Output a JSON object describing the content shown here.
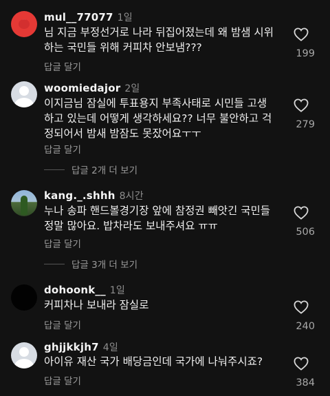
{
  "comments": [
    {
      "username": "mul__77077",
      "time": "1일",
      "text": "님 지금 부정선거로 나라 뒤집어졌는데 왜 밤샘 시위\n하는 국민들 위해 커피차 안보냄???",
      "reply_label": "답글 달기",
      "likes": "199",
      "avatar": "red-character-avatar"
    },
    {
      "username": "woomiedajor",
      "time": "2일",
      "text": "이지금님 잠실에 투표용지 부족사태로 시민들 고생\n하고 있는데 어떻게 생각하세요?? 너무 불안하고 걱\n정되어서 밤새 밤잠도 못잤어요ㅜㅜ",
      "reply_label": "답글 달기",
      "likes": "279",
      "more_replies": "답글 2개 더 보기",
      "avatar": "default-avatar"
    },
    {
      "username": "kang._.shhh",
      "time": "8시간",
      "text": "누나 송파 핸드볼경기장 앞에 참정권 빼앗긴 국민들\n정말 많아요. 밥차라도 보내주셔요 ㅠㅠ",
      "reply_label": "답글 달기",
      "likes": "506",
      "more_replies": "답글 3개 더 보기",
      "avatar": "tree-photo-avatar"
    },
    {
      "username": "dohoonk__",
      "time": "1일",
      "text": "커피차나 보내라 잠실로",
      "reply_label": "답글 달기",
      "likes": "240",
      "avatar": "black-avatar"
    },
    {
      "username": "ghjjkkjh7",
      "time": "4일",
      "text": "아이유 재산 국가 배당금인데 국가에 나눠주시죠?",
      "reply_label": "답글 달기",
      "likes": "384",
      "avatar": "default-avatar"
    }
  ]
}
